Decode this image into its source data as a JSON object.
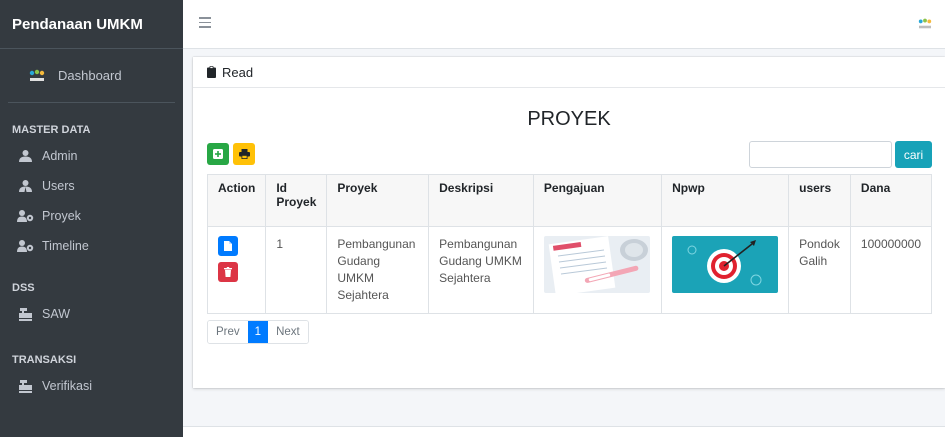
{
  "sidebar": {
    "brand": "Pendanaan UMKM",
    "user": "Dashboard",
    "sections": [
      {
        "header": "MASTER DATA",
        "items": [
          "Admin",
          "Users",
          "Proyek",
          "Timeline"
        ]
      },
      {
        "header": "DSS",
        "items": [
          "SAW"
        ]
      },
      {
        "header": "TRANSAKSI",
        "items": [
          "Verifikasi"
        ]
      }
    ]
  },
  "card": {
    "header": "Read",
    "title": "PROYEK"
  },
  "search": {
    "placeholder": "",
    "button": "cari"
  },
  "table": {
    "headers": [
      "Action",
      "Id Proyek",
      "Proyek",
      "Deskripsi",
      "Pengajuan",
      "Npwp",
      "users",
      "Dana"
    ],
    "rows": [
      {
        "id": "1",
        "proyek": "Pembangunan Gudang UMKM Sejahtera",
        "deskripsi": "Pembangunan Gudang UMKM Sejahtera",
        "users": "Pondok Galih",
        "dana": "100000000"
      }
    ]
  },
  "pagination": {
    "prev": "Prev",
    "current": "1",
    "next": "Next"
  },
  "colors": {
    "sidebar": "#343a40",
    "primary": "#007bff",
    "success": "#28a745",
    "warning": "#ffc107",
    "danger": "#dc3545",
    "info": "#17a2b8"
  }
}
